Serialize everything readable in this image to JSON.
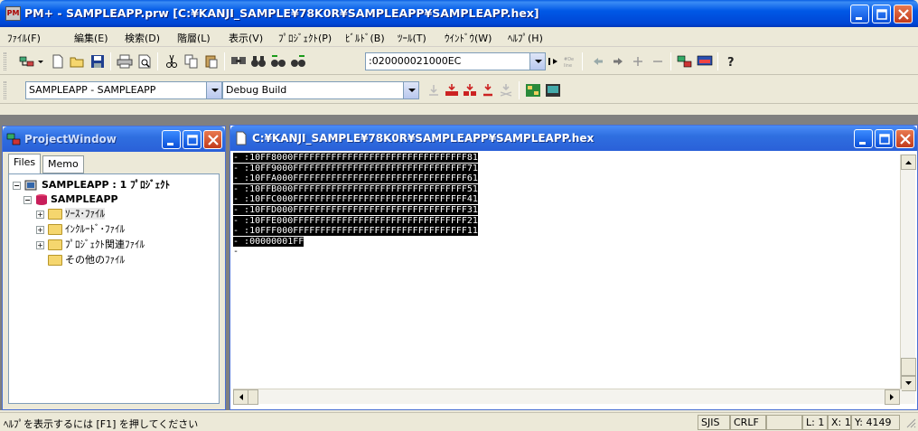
{
  "window": {
    "title": "PM+ - SAMPLEAPP.prw [C:¥KANJI_SAMPLE¥78K0R¥SAMPLEAPP¥SAMPLEAPP.hex]",
    "app_icon_text": "PM"
  },
  "menu": [
    "ﾌｧｲﾙ(F)",
    "編集(E)",
    "検索(D)",
    "階層(L)",
    "表示(V)",
    "ﾌﾟﾛｼﾞｪｸﾄ(P)",
    "ﾋﾞﾙﾄﾞ(B)",
    "ﾂｰﾙ(T)",
    "ｳｲﾝﾄﾞｳ(W)",
    "ﾍﾙﾌﾟ(H)"
  ],
  "toolbar1": {
    "search_value": ":020000021000EC"
  },
  "toolbar2": {
    "project_combo": "SAMPLEAPP - SAMPLEAPP",
    "build_combo": "Debug Build"
  },
  "project_window": {
    "title": "ProjectWindow",
    "tabs": [
      "Files",
      "Memo"
    ],
    "root": "SAMPLEAPP : 1 ﾌﾟﾛｼﾞｪｸﾄ",
    "project": "SAMPLEAPP",
    "folders": [
      "ｿｰｽ･ﾌｧｲﾙ",
      "ｲﾝｸﾙｰﾄﾞ･ﾌｧｲﾙ",
      "ﾌﾟﾛｼﾞｪｸﾄ関連ﾌｧｲﾙ",
      "その他のﾌｧｲﾙ"
    ]
  },
  "hex_window": {
    "title": "C:¥KANJI_SAMPLE¥78K0R¥SAMPLEAPP¥SAMPLEAPP.hex",
    "lines": [
      ":10FF8000FFFFFFFFFFFFFFFFFFFFFFFFFFFFFFFF81",
      ":10FF9000FFFFFFFFFFFFFFFFFFFFFFFFFFFFFFFF71",
      ":10FFA000FFFFFFFFFFFFFFFFFFFFFFFFFFFFFFFF61",
      ":10FFB000FFFFFFFFFFFFFFFFFFFFFFFFFFFFFFFF51",
      ":10FFC000FFFFFFFFFFFFFFFFFFFFFFFFFFFFFFFF41",
      ":10FFD000FFFFFFFFFFFFFFFFFFFFFFFFFFFFFFFF31",
      ":10FFE000FFFFFFFFFFFFFFFFFFFFFFFFFFFFFFFF21",
      ":10FFF000FFFFFFFFFFFFFFFFFFFFFFFFFFFFFFFF11",
      ":00000001FF"
    ]
  },
  "statusbar": {
    "help": "ﾍﾙﾌﾟを表示するには [F1] を押してください",
    "encoding": "SJIS",
    "newline": "CRLF",
    "line": "L: 1",
    "col": "X: 1",
    "y": "Y: 4149"
  }
}
